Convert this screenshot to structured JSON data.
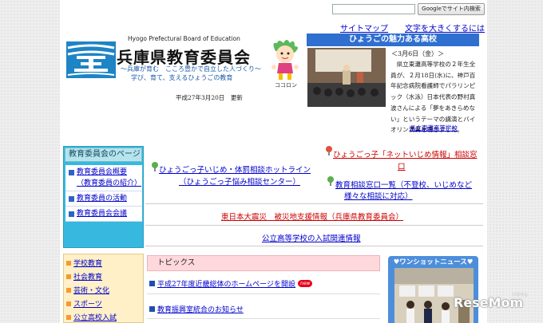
{
  "header": {
    "search_placeholder": "",
    "search_button": "Googleでサイト内検索",
    "sitemap_link": "サイトマップ",
    "textsize_link": "文字を大きくするには",
    "org_en": "Hyogo Prefectural Board of Education",
    "org_jp": "兵庫県教育委員会",
    "slogan_line1": "〜兵庫が育む　こころ豊かで自立した人づくり〜",
    "slogan_line2": "学び、育て、支えるひょうごの教育",
    "mascot_name": "ココロン",
    "updated": "平成27年3月20日　更新"
  },
  "feature": {
    "heading": "ひょうごの魅力ある高校",
    "date": "＜3月6日（金）＞",
    "body": "　県立東灘高等学校の２年生全員が、２月18日(水)に、神戸百年記念病院看護師でパラリンピック（水泳）日本代表の野村真波さんによる「夢をあきらめない」というテーマの講演とバイオリン演奏を聴きました。",
    "school_link": "県立東灘高等学校"
  },
  "nav1": {
    "title": "教育委員会のページ",
    "items": [
      {
        "label": "教育委員会概要（教育委員の紹介）"
      },
      {
        "label": "教育委員の活動"
      },
      {
        "label": "教育委員会会議"
      }
    ]
  },
  "consult": {
    "hotline_line1": "ひょうごっ子いじめ・体罰相談ホットライン",
    "hotline_line2": "（ひょうごっ子悩み相談センター）",
    "net_line1": "ひょうごっ子「ネットいじめ情報」相談窓",
    "net_line2": "口",
    "list_line1": "教育相談窓口一覧（不登校、いじめなど",
    "list_line2": "様々な相談に対応）",
    "disaster": "東日本大震災　被災地支援情報（兵庫県教育委員会）",
    "exam": "公立高等学校の入試関連情報"
  },
  "nav2": {
    "items": [
      {
        "label": "学校教育"
      },
      {
        "label": "社会教育"
      },
      {
        "label": "芸術・文化"
      },
      {
        "label": "スポーツ"
      },
      {
        "label": "公立高校入試"
      }
    ]
  },
  "topics": {
    "heading": "トピックス",
    "items": [
      {
        "label": "平成27年度近畿総体のホームページを開設",
        "badge": "new"
      },
      {
        "label": "教育振興室統合のお知らせ",
        "badge": ""
      }
    ]
  },
  "oneshot": {
    "title": "♥ワンショットニュース♥"
  },
  "watermark": {
    "brand": "ReseMom",
    "small": "リセマム"
  },
  "colors": {
    "feature_head": "#2f6fd0",
    "nav1_bg": "#37b8df",
    "nav2_bg": "#fff0c8",
    "topics_head": "#ffd8dc",
    "oneshot_bg": "#4d8edb",
    "link": "#0000cc",
    "alert_link": "#cc0000"
  }
}
